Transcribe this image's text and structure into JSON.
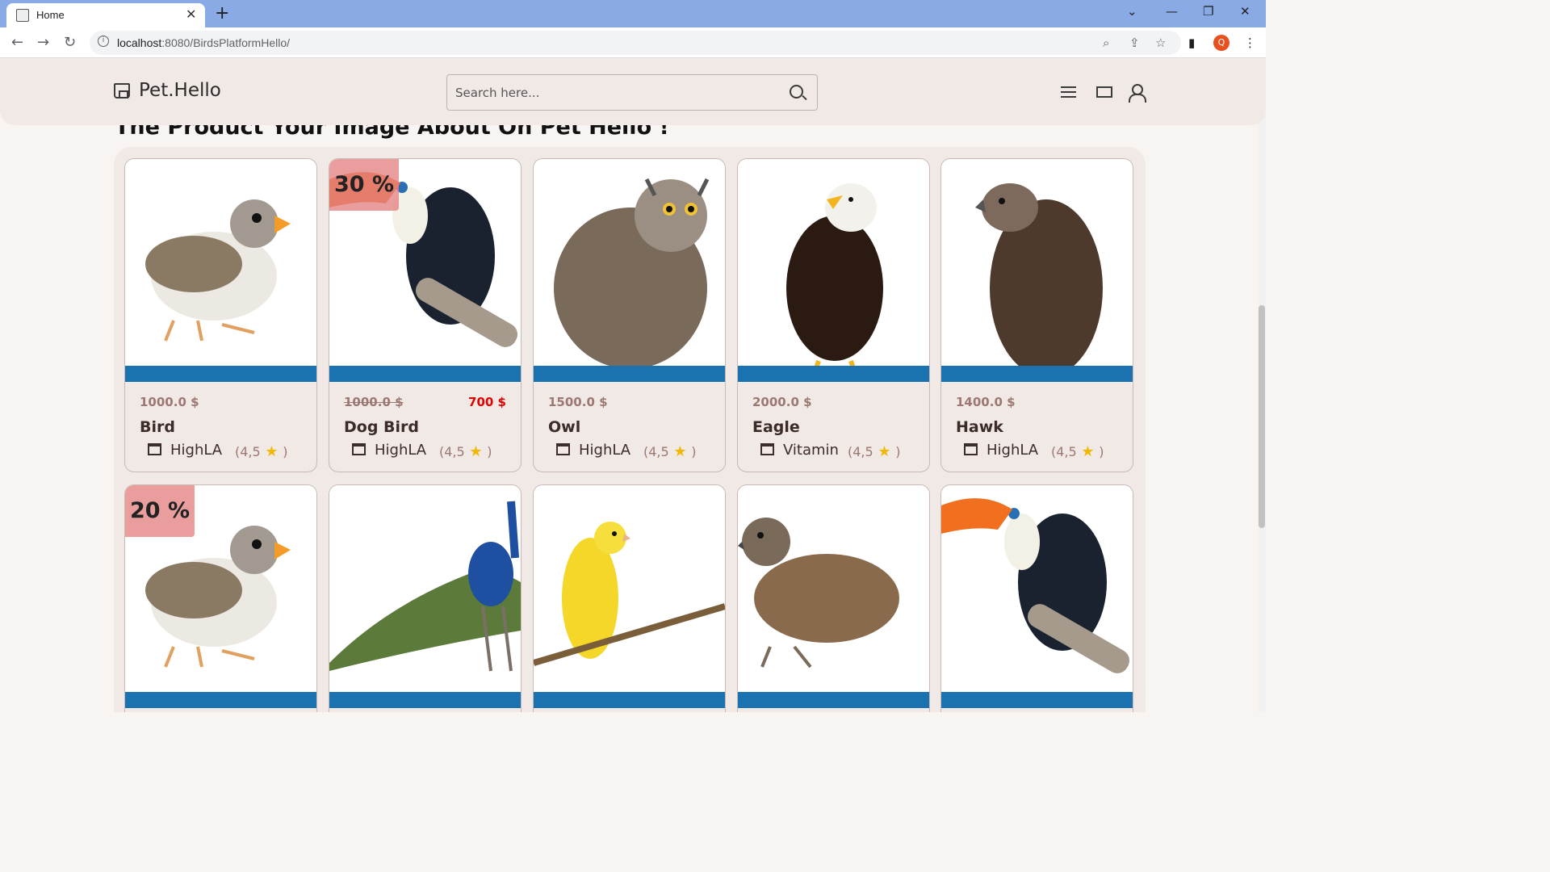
{
  "browser": {
    "tab_title": "Home",
    "url_host": "localhost",
    "url_rest": ":8080/BirdsPlatformHello/",
    "profile_initial": "Q"
  },
  "header": {
    "logo": "Pet.Hello",
    "search_placeholder": "Search here..."
  },
  "section_title": "The Product Your Image About On Pet Hello !",
  "products": [
    {
      "price": "1000.0 $",
      "sale_price": "",
      "discount": "",
      "name": "Bird",
      "shop": "HighLA",
      "rating": "(4,5",
      "rating_end": ")",
      "bird": "finch"
    },
    {
      "price": "1000.0 $",
      "sale_price": "700 $",
      "discount": "30 %",
      "name": "Dog Bird",
      "shop": "HighLA",
      "rating": "(4,5",
      "rating_end": ")",
      "bird": "toucan"
    },
    {
      "price": "1500.0 $",
      "sale_price": "",
      "discount": "",
      "name": "Owl",
      "shop": "HighLA",
      "rating": "(4,5",
      "rating_end": ")",
      "bird": "owl"
    },
    {
      "price": "2000.0 $",
      "sale_price": "",
      "discount": "",
      "name": "Eagle",
      "shop": "Vitamin",
      "rating": "(4,5",
      "rating_end": ")",
      "bird": "eagle"
    },
    {
      "price": "1400.0 $",
      "sale_price": "",
      "discount": "",
      "name": "Hawk",
      "shop": "HighLA",
      "rating": "(4,5",
      "rating_end": ")",
      "bird": "hawk"
    },
    {
      "discount": "20 %",
      "bird": "finch"
    },
    {
      "discount": "",
      "bird": "peacock"
    },
    {
      "discount": "",
      "bird": "canary"
    },
    {
      "discount": "",
      "bird": "sparrow"
    },
    {
      "discount": "",
      "bird": "toucan"
    }
  ]
}
